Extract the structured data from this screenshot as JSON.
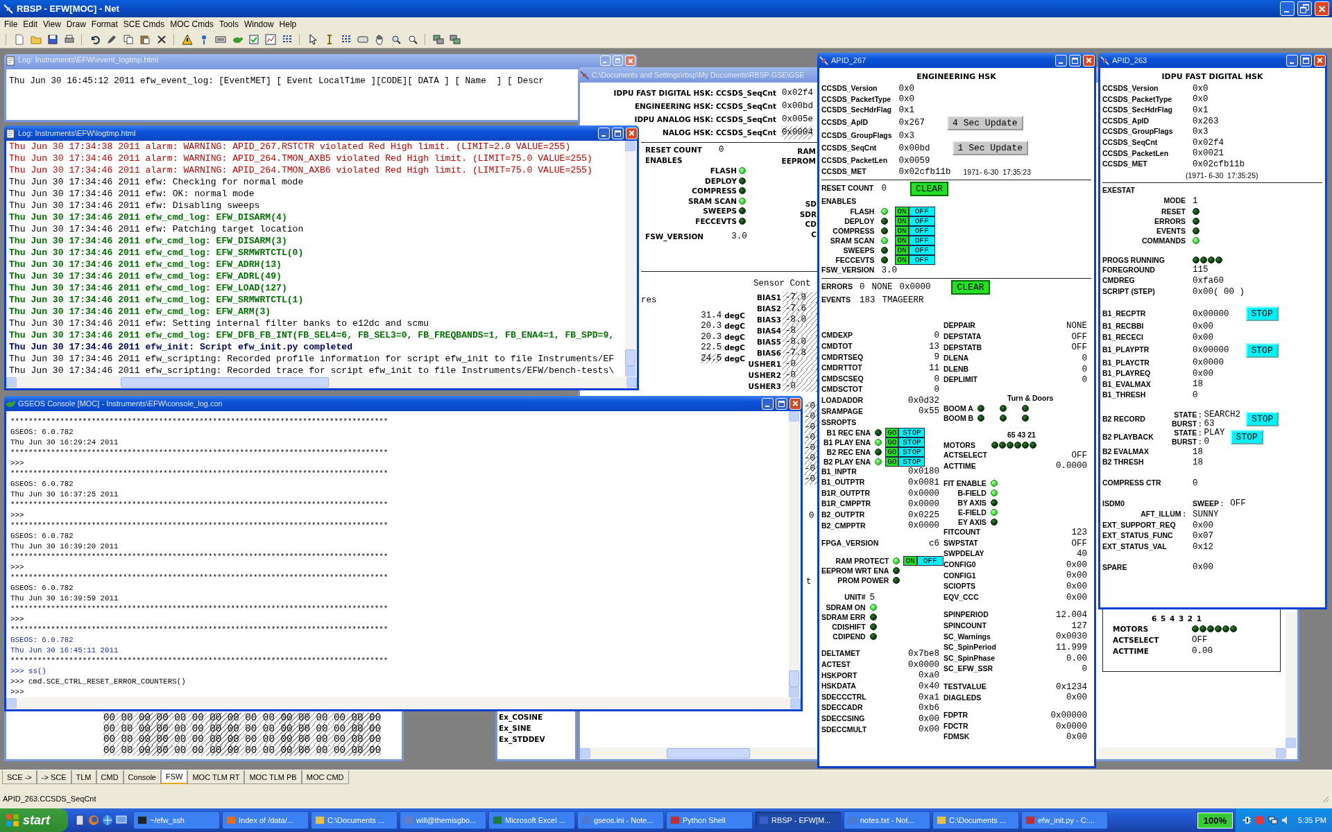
{
  "app": {
    "title": "RBSP - EFW[MOC] - Net",
    "menu": [
      "File",
      "Edit",
      "View",
      "Draw",
      "Format",
      "SCE Cmds",
      "MOC Cmds",
      "Tools",
      "Window",
      "Help"
    ]
  },
  "event_log_window": {
    "title": "Log: Instruments\\EFW\\event_logtmp.html",
    "line": "Thu Jun 30 16:45:12 2011 efw_event_log: [EventMET] [ Event LocalTime ][CODE][ DATA ] [ Name  ] [ Descr"
  },
  "display_window": {
    "title": "C:\\Documents and Settings\\rbsp\\My Documents\\RBSP-GSE\\GSE",
    "seq_rows": [
      {
        "label": "IDPU FAST DIGITAL HSK: CCSDS_SeqCnt",
        "value": "0x02f4",
        "stale": false
      },
      {
        "label": "ENGINEERING HSK: CCSDS_SeqCnt",
        "value": "0x00bd",
        "stale": false
      },
      {
        "label": "IDPU ANALOG HSK: CCSDS_SeqCnt",
        "value": "0x005e",
        "stale": false
      },
      {
        "label": "NALOG HSK: CCSDS_SeqCnt",
        "value": "0x0004",
        "stale": true
      }
    ],
    "engineering": {
      "reset_label": "RESET COUNT",
      "reset_value": "0",
      "enables_label": "ENABLES",
      "enables": [
        {
          "label": "FLASH",
          "on": true
        },
        {
          "label": "DEPLOY",
          "on": false
        },
        {
          "label": "COMPRESS",
          "on": false
        },
        {
          "label": "SRAM SCAN",
          "on": true
        },
        {
          "label": "SWEEPS",
          "on": false
        },
        {
          "label": "FECCEVTS",
          "on": false
        }
      ],
      "fsw_label": "FSW_VERSION",
      "fsw_value": "3.0",
      "cut_labels_top": [
        "RAM",
        "EEPROM"
      ],
      "cut_labels_bottom": [
        "SD",
        "SDR",
        "CD",
        "C"
      ]
    },
    "sensors": {
      "temps_heading": "res",
      "temps": [
        {
          "value": "31.4",
          "unit": "degC",
          "stale": false
        },
        {
          "value": "20.3",
          "unit": "degC",
          "stale": false
        },
        {
          "value": "20.3",
          "unit": "degC",
          "stale": false
        },
        {
          "value": "22.5",
          "unit": "degC",
          "stale": false
        },
        {
          "value": "24.5",
          "unit": "degC",
          "stale": true
        }
      ],
      "heading": "Sensor Cont",
      "rows": [
        {
          "label": "BIAS1",
          "value": "-7.9"
        },
        {
          "label": "BIAS2",
          "value": "-7.6"
        },
        {
          "label": "BIAS3",
          "value": "-8.0"
        },
        {
          "label": "BIAS4",
          "value": "-8"
        },
        {
          "label": "BIAS5",
          "value": "-8.0"
        },
        {
          "label": "BIAS6",
          "value": "-7.8"
        },
        {
          "label": "USHER1",
          "value": "-0"
        },
        {
          "label": "USHER2",
          "value": "-0"
        },
        {
          "label": "USHER3",
          "value": "-0"
        }
      ],
      "more_values": [
        "-0",
        "-0",
        "-0",
        "-0",
        "-0",
        "-0",
        "-0",
        "-0"
      ],
      "fragments": [
        "0",
        "t"
      ]
    },
    "motors_box": {
      "digits": "6 5 4 3 2 1",
      "label": "MOTORS",
      "lamps": [
        false,
        false,
        false,
        false,
        false,
        false
      ],
      "rows": [
        {
          "label": "ACTSELECT",
          "value": "OFF"
        },
        {
          "label": "ACTTIME",
          "value": "0.00"
        }
      ]
    }
  },
  "log_window": {
    "title": "Log: Instruments\\EFW\\logtmp.html",
    "lines": [
      {
        "kind": "alarm",
        "text": "Thu Jun 30 17:34:38 2011 alarm: WARNING: APID_267.RSTCTR violated Red High limit. (LIMIT=2.0 VALUE=255)"
      },
      {
        "kind": "alarm",
        "text": "Thu Jun 30 17:34:46 2011 alarm: WARNING: APID_264.TMON_AXB5 violated Red High limit. (LIMIT=75.0 VALUE=255)"
      },
      {
        "kind": "alarm",
        "text": "Thu Jun 30 17:34:46 2011 alarm: WARNING: APID_264.TMON_AXB6 violated Red High limit. (LIMIT=75.0 VALUE=255)"
      },
      {
        "kind": "info",
        "text": "Thu Jun 30 17:34:46 2011 efw: Checking for normal mode"
      },
      {
        "kind": "info",
        "text": "Thu Jun 30 17:34:46 2011 efw: OK: normal mode"
      },
      {
        "kind": "info",
        "text": "Thu Jun 30 17:34:46 2011 efw: Disabling sweeps"
      },
      {
        "kind": "command",
        "text": "Thu Jun 30 17:34:46 2011 efw_cmd_log: EFW_DISARM(4)"
      },
      {
        "kind": "info",
        "text": "Thu Jun 30 17:34:46 2011 efw: Patching target location"
      },
      {
        "kind": "command",
        "text": "Thu Jun 30 17:34:46 2011 efw_cmd_log: EFW_DISARM(3)"
      },
      {
        "kind": "command",
        "text": "Thu Jun 30 17:34:46 2011 efw_cmd_log: EFW_SRMWRTCTL(0)"
      },
      {
        "kind": "command",
        "text": "Thu Jun 30 17:34:46 2011 efw_cmd_log: EFW_ADRH(13)"
      },
      {
        "kind": "command",
        "text": "Thu Jun 30 17:34:46 2011 efw_cmd_log: EFW_ADRL(49)"
      },
      {
        "kind": "command",
        "text": "Thu Jun 30 17:34:46 2011 efw_cmd_log: EFW_LOAD(127)"
      },
      {
        "kind": "command",
        "text": "Thu Jun 30 17:34:46 2011 efw_cmd_log: EFW_SRMWRTCTL(1)"
      },
      {
        "kind": "command",
        "text": "Thu Jun 30 17:34:46 2011 efw_cmd_log: EFW_ARM(3)"
      },
      {
        "kind": "info",
        "text": "Thu Jun 30 17:34:46 2011 efw: Setting internal filter banks to e12dc and scmu"
      },
      {
        "kind": "command",
        "text": "Thu Jun 30 17:34:46 2011 efw_cmd_log: EFW_DFB_FB_INT(FB_SEL4=6, FB_SEL3=0, FB_FREQBANDS=1, FB_ENA4=1, FB_SPD=9,"
      },
      {
        "kind": "script",
        "text": "Thu Jun 30 17:34:46 2011 efw_init: Script efw_init.py completed"
      },
      {
        "kind": "info",
        "text": "Thu Jun 30 17:34:46 2011 efw_scripting: Recorded profile information for script efw_init to file Instruments/EF"
      },
      {
        "kind": "info",
        "text": "Thu Jun 30 17:34:46 2011 efw_scripting: Recorded trace for script efw_init to file Instruments/EFW/bench-tests\\"
      }
    ]
  },
  "console_window": {
    "title": "GSEOS Console [MOC] - Instruments\\EFW\\console_log.con",
    "lines": [
      {
        "kind": "output",
        "text": "************************************************************************************"
      },
      {
        "kind": "output",
        "text": "GSEOS: 6.0.782"
      },
      {
        "kind": "output",
        "text": "Thu Jun 30 16:29:24 2011"
      },
      {
        "kind": "output",
        "text": "************************************************************************************"
      },
      {
        "kind": "output",
        "text": ">>>"
      },
      {
        "kind": "output",
        "text": "************************************************************************************"
      },
      {
        "kind": "output",
        "text": "GSEOS: 6.0.782"
      },
      {
        "kind": "output",
        "text": "Thu Jun 30 16:37:25 2011"
      },
      {
        "kind": "output",
        "text": "************************************************************************************"
      },
      {
        "kind": "output",
        "text": ">>>"
      },
      {
        "kind": "output",
        "text": "************************************************************************************"
      },
      {
        "kind": "output",
        "text": "GSEOS: 6.0.782"
      },
      {
        "kind": "output",
        "text": "Thu Jun 30 16:39:20 2011"
      },
      {
        "kind": "output",
        "text": "************************************************************************************"
      },
      {
        "kind": "output",
        "text": ">>>"
      },
      {
        "kind": "output",
        "text": "************************************************************************************"
      },
      {
        "kind": "output",
        "text": "GSEOS: 6.0.782"
      },
      {
        "kind": "output",
        "text": "Thu Jun 30 16:39:59 2011"
      },
      {
        "kind": "output",
        "text": "************************************************************************************"
      },
      {
        "kind": "output",
        "text": ">>>"
      },
      {
        "kind": "output",
        "text": "************************************************************************************"
      },
      {
        "kind": "highlight",
        "text": "GSEOS: 6.0.782"
      },
      {
        "kind": "highlight",
        "text": "Thu Jun 30 16:45:11 2011"
      },
      {
        "kind": "output",
        "text": "************************************************************************************"
      },
      {
        "kind": "highlight",
        "text": ">>> ss()"
      },
      {
        "kind": "output",
        "text": ">>> cmd.SCE_CTRL_RESET_ERROR_COUNTERS()"
      },
      {
        "kind": "output",
        "text": ">>>"
      }
    ]
  },
  "hex_window": {
    "rows": [
      "00 00 00 00 00 00 00 00 00 00 00 00 00 00 00 00",
      "00 00 00 00 00 00 00 00 00 00 00 00 00 00 00 00",
      "00 00 00 00 00 00 00 00 00 00 00 00 00 00 00 00",
      "00 00 00 00 00 00 00 00 00 00 00 00 00 00 00 00"
    ]
  },
  "function_list": {
    "items": [
      "Ex_COSINE",
      "Ex_SINE",
      "Ex_STDDEV"
    ]
  },
  "hsk_windows": [
    {
      "title": "APID_267",
      "sections": [
        {
          "columns": [
            [
              [
                {
                  "kind": "title",
                  "label": "ENGINEERING HSK"
                },
                {
                  "kind": "value",
                  "label": "CCSDS_Version",
                  "values": [
                    "0x0"
                  ]
                },
                {
                  "kind": "value",
                  "label": "CCSDS_PacketType",
                  "values": [
                    "0x0"
                  ]
                },
                {
                  "kind": "value",
                  "label": "CCSDS_SecHdrFlag",
                  "values": [
                    "0x1"
                  ]
                },
                {
                  "kind": "value",
                  "label": "CCSDS_ApID",
                  "values": [
                    "0x267"
                  ],
                  "button": {
                    "label": "4 Sec Update",
                    "kind": "update"
                  }
                },
                {
                  "kind": "value",
                  "label": "CCSDS_GroupFlags",
                  "values": [
                    "0x3"
                  ]
                },
                {
                  "kind": "value",
                  "label": "CCSDS_SeqCnt",
                  "values": [
                    "0x00bd"
                  ],
                  "button": {
                    "label": "1 Sec Update",
                    "kind": "update"
                  }
                },
                {
                  "kind": "value",
                  "label": "CCSDS_PacketLen",
                  "values": [
                    "0x0059"
                  ]
                },
                {
                  "kind": "value",
                  "label": "CCSDS_MET",
                  "values": [
                    "0x02cfb11b"
                  ],
                  "note": "1971- 6-30  17:35:23"
                }
              ]
            ]
          ]
        },
        {
          "divider": true,
          "columns": [
            [
              [
                {
                  "kind": "value",
                  "label": "RESET COUNT",
                  "values": [
                    "0"
                  ],
                  "button": {
                    "label": "CLEAR",
                    "kind": "clear"
                  }
                },
                {
                  "kind": "heading",
                  "label": "ENABLES"
                },
                {
                  "kind": "lamp",
                  "label": "FLASH",
                  "lamps": [
                    true
                  ],
                  "switch": [
                    "ON",
                    "OFF"
                  ]
                },
                {
                  "kind": "lamp",
                  "label": "DEPLOY",
                  "lamps": [
                    false
                  ],
                  "switch": [
                    "ON",
                    "OFF"
                  ]
                },
                {
                  "kind": "lamp",
                  "label": "COMPRESS",
                  "lamps": [
                    false
                  ],
                  "switch": [
                    "ON",
                    "OFF"
                  ]
                },
                {
                  "kind": "lamp",
                  "label": "SRAM SCAN",
                  "lamps": [
                    true
                  ],
                  "switch": [
                    "ON",
                    "OFF"
                  ]
                },
                {
                  "kind": "lamp",
                  "label": "SWEEPS",
                  "lamps": [
                    false
                  ],
                  "switch": [
                    "ON",
                    "OFF"
                  ]
                },
                {
                  "kind": "lamp",
                  "label": "FECCEVTS",
                  "lamps": [
                    false
                  ],
                  "switch": [
                    "ON",
                    "OFF"
                  ]
                },
                {
                  "kind": "value",
                  "label": "FSW_VERSION",
                  "values": [
                    "3.0"
                  ]
                }
              ]
            ]
          ]
        },
        {
          "divider": true,
          "columns": [
            [
              [
                {
                  "kind": "value",
                  "label": "ERRORS",
                  "values": [
                    "0",
                    "NONE",
                    "0x0000"
                  ],
                  "button": {
                    "label": "CLEAR",
                    "kind": "clear"
                  }
                },
                {
                  "kind": "value",
                  "label": "EVENTS",
                  "values": [
                    "183",
                    "TMAGEERR"
                  ]
                }
              ]
            ]
          ]
        },
        {
          "columns": [
            [
              [
                {
                  "kind": "value",
                  "label": "CMDEXP",
                  "values": [
                    "0"
                  ]
                },
                {
                  "kind": "value",
                  "label": "CMDTOT",
                  "values": [
                    "13"
                  ]
                },
                {
                  "kind": "value",
                  "label": "CMDRTSEQ",
                  "values": [
                    "9"
                  ]
                },
                {
                  "kind": "value",
                  "label": "CMDRTTOT",
                  "values": [
                    "11"
                  ]
                },
                {
                  "kind": "value",
                  "label": "CMDSCSEQ",
                  "values": [
                    "0"
                  ]
                },
                {
                  "kind": "value",
                  "label": "CMDSCTOT",
                  "values": [
                    "0"
                  ]
                },
                {
                  "kind": "value",
                  "label": "LOADADDR",
                  "values": [
                    "0x0d32"
                  ]
                },
                {
                  "kind": "value",
                  "label": "SRAMPAGE",
                  "values": [
                    "0x55"
                  ]
                },
                {
                  "kind": "heading",
                  "label": "SSROPTS"
                },
                {
                  "kind": "lamp",
                  "label": "B1 REC ENA",
                  "lamps": [
                    false
                  ],
                  "switch": [
                    "GO",
                    "STOP"
                  ]
                },
                {
                  "kind": "lamp",
                  "label": "B1 PLAY ENA",
                  "lamps": [
                    true
                  ],
                  "switch": [
                    "GO",
                    "STOP"
                  ]
                },
                {
                  "kind": "lamp",
                  "label": "B2 REC ENA",
                  "lamps": [
                    false
                  ],
                  "switch": [
                    "GO",
                    "STOP"
                  ]
                },
                {
                  "kind": "lamp",
                  "label": "B2 PLAY ENA",
                  "lamps": [
                    true
                  ],
                  "switch": [
                    "GO",
                    "STOP"
                  ]
                },
                {
                  "kind": "value",
                  "label": "B1_INPTR",
                  "values": [
                    "0x0180"
                  ]
                },
                {
                  "kind": "value",
                  "label": "B1_OUTPTR",
                  "values": [
                    "0x0081"
                  ]
                },
                {
                  "kind": "value",
                  "label": "B1R_OUTPTR",
                  "values": [
                    "0x0000"
                  ]
                },
                {
                  "kind": "value",
                  "label": "B1R_CMPPTR",
                  "values": [
                    "0x0000"
                  ]
                },
                {
                  "kind": "value",
                  "label": "B2_OUTPTR",
                  "values": [
                    "0x0225"
                  ]
                },
                {
                  "kind": "value",
                  "label": "B2_CMPPTR",
                  "values": [
                    "0x0000"
                  ]
                }
              ],
              [
                {
                  "kind": "value",
                  "label": "FPGA_VERSION",
                  "values": [
                    "c6"
                  ]
                }
              ],
              [
                {
                  "kind": "lamp",
                  "label": "RAM PROTECT",
                  "lamps": [
                    true
                  ],
                  "switch": [
                    "ON",
                    "OFF"
                  ]
                },
                {
                  "kind": "lamp",
                  "label": "EEPROM WRT ENA",
                  "lamps": [
                    false
                  ]
                },
                {
                  "kind": "lamp",
                  "label": "PROM POWER",
                  "lamps": [
                    false
                  ]
                }
              ],
              [
                {
                  "kind": "sub",
                  "label": "UNIT#",
                  "values": [
                    "5"
                  ]
                },
                {
                  "kind": "lamp",
                  "label": "SDRAM ON",
                  "lamps": [
                    true
                  ]
                },
                {
                  "kind": "lamp",
                  "label": "SDRAM ERR",
                  "lamps": [
                    false
                  ]
                },
                {
                  "kind": "lamp",
                  "label": "CDISHIFT",
                  "lamps": [
                    false
                  ]
                },
                {
                  "kind": "lamp",
                  "label": "CDIPEND",
                  "lamps": [
                    false
                  ]
                }
              ],
              [
                {
                  "kind": "value",
                  "label": "DELTAMET",
                  "values": [
                    "0x7be8"
                  ]
                },
                {
                  "kind": "value",
                  "label": "ACTEST",
                  "values": [
                    "0x0000"
                  ]
                },
                {
                  "kind": "value",
                  "label": "HSKPORT",
                  "values": [
                    "0xa0"
                  ]
                },
                {
                  "kind": "value",
                  "label": "HSKDATA",
                  "values": [
                    "0x40"
                  ]
                },
                {
                  "kind": "value",
                  "label": "SDECCCTRL",
                  "values": [
                    "0xa1"
                  ]
                },
                {
                  "kind": "value",
                  "label": "SDECCADR",
                  "values": [
                    "0xb6"
                  ]
                },
                {
                  "kind": "value",
                  "label": "SDECCSING",
                  "values": [
                    "0x00"
                  ]
                },
                {
                  "kind": "value",
                  "label": "SDECCMULT",
                  "values": [
                    "0x00"
                  ]
                }
              ]
            ],
            [
              [
                {
                  "kind": "value",
                  "label": "DEPPAIR",
                  "values": [
                    "NONE"
                  ]
                },
                {
                  "kind": "value",
                  "label": "DEPSTATA",
                  "values": [
                    "OFF"
                  ]
                },
                {
                  "kind": "value",
                  "label": "DEPSTATB",
                  "values": [
                    "OFF"
                  ]
                },
                {
                  "kind": "value",
                  "label": "DLENA",
                  "values": [
                    "0"
                  ]
                },
                {
                  "kind": "value",
                  "label": "DLENB",
                  "values": [
                    "0"
                  ]
                },
                {
                  "kind": "value",
                  "label": "DEPLIMIT",
                  "values": [
                    "0"
                  ]
                }
              ],
              [
                {
                  "kind": "caption",
                  "label": "Turn & Doors"
                },
                {
                  "kind": "lamp_row",
                  "label": "BOOM A",
                  "lamps": [
                    false,
                    false,
                    false
                  ]
                },
                {
                  "kind": "lamp_row",
                  "label": "BOOM B",
                  "lamps": [
                    false,
                    false,
                    false
                  ]
                }
              ],
              [
                {
                  "kind": "caption",
                  "label": "65 43 21"
                },
                {
                  "kind": "lamp_row",
                  "label": "MOTORS",
                  "lamps": [
                    false,
                    false,
                    false,
                    false,
                    false,
                    false
                  ]
                },
                {
                  "kind": "value",
                  "label": "ACTSELECT",
                  "values": [
                    "OFF"
                  ]
                },
                {
                  "kind": "value",
                  "label": "ACTTIME",
                  "values": [
                    "0.0000"
                  ]
                }
              ],
              [
                {
                  "kind": "lamp",
                  "label": "FIT ENABLE",
                  "lamps": [
                    true
                  ]
                },
                {
                  "kind": "lamp",
                  "label": "B-FIELD",
                  "lamps": [
                    true
                  ]
                },
                {
                  "kind": "lamp",
                  "label": "BY AXIS",
                  "lamps": [
                    false
                  ]
                },
                {
                  "kind": "lamp",
                  "label": "E-FIELD",
                  "lamps": [
                    true
                  ]
                },
                {
                  "kind": "lamp",
                  "label": "EY AXIS",
                  "lamps": [
                    false
                  ]
                },
                {
                  "kind": "value",
                  "label": "FITCOUNT",
                  "values": [
                    "123"
                  ]
                },
                {
                  "kind": "value",
                  "label": "SWPSTAT",
                  "values": [
                    "OFF"
                  ]
                },
                {
                  "kind": "value",
                  "label": "SWPDELAY",
                  "values": [
                    "40"
                  ]
                },
                {
                  "kind": "value",
                  "label": "CONFIG0",
                  "values": [
                    "0x00"
                  ]
                },
                {
                  "kind": "value",
                  "label": "CONFIG1",
                  "values": [
                    "0x00"
                  ]
                },
                {
                  "kind": "value",
                  "label": "SCIOPTS",
                  "values": [
                    "0x00"
                  ]
                },
                {
                  "kind": "value",
                  "label": "EQV_CCC",
                  "values": [
                    "0x00"
                  ]
                }
              ],
              [
                {
                  "kind": "value",
                  "label": "SPINPERIOD",
                  "values": [
                    "12.004"
                  ]
                },
                {
                  "kind": "value",
                  "label": "SPINCOUNT",
                  "values": [
                    "127"
                  ]
                },
                {
                  "kind": "value",
                  "label": "SC_Warnings",
                  "values": [
                    "0x0030"
                  ]
                },
                {
                  "kind": "value",
                  "label": "SC_SpinPeriod",
                  "values": [
                    "11.999"
                  ]
                },
                {
                  "kind": "value",
                  "label": "SC_SpinPhase",
                  "values": [
                    "0.00"
                  ]
                },
                {
                  "kind": "value",
                  "label": "SC_EFW_SSR",
                  "values": [
                    "0"
                  ]
                }
              ],
              [
                {
                  "kind": "value",
                  "label": "TESTVALUE",
                  "values": [
                    "0x1234"
                  ]
                },
                {
                  "kind": "value",
                  "label": "DIAGLEDS",
                  "values": [
                    "0x00"
                  ]
                }
              ],
              [
                {
                  "kind": "value",
                  "label": "FDPTR",
                  "values": [
                    "0x00000"
                  ]
                },
                {
                  "kind": "value",
                  "label": "FDCTR",
                  "values": [
                    "0x0000"
                  ]
                },
                {
                  "kind": "value",
                  "label": "FDMSK",
                  "values": [
                    "0x00"
                  ]
                }
              ]
            ]
          ]
        }
      ]
    },
    {
      "title": "APID_263",
      "sections": [
        {
          "columns": [
            [
              [
                {
                  "kind": "title",
                  "label": "IDPU FAST DIGITAL HSK"
                },
                {
                  "kind": "value",
                  "label": "CCSDS_Version",
                  "values": [
                    "0x0"
                  ]
                },
                {
                  "kind": "value",
                  "label": "CCSDS_PacketType",
                  "values": [
                    "0x0"
                  ]
                },
                {
                  "kind": "value",
                  "label": "CCSDS_SecHdrFlag",
                  "values": [
                    "0x1"
                  ]
                },
                {
                  "kind": "value",
                  "label": "CCSDS_ApID",
                  "values": [
                    "0x263"
                  ]
                },
                {
                  "kind": "value",
                  "label": "CCSDS_GroupFlags",
                  "values": [
                    "0x3"
                  ]
                },
                {
                  "kind": "value",
                  "label": "CCSDS_SeqCnt",
                  "values": [
                    "0x02f4"
                  ]
                },
                {
                  "kind": "value",
                  "label": "CCSDS_PacketLen",
                  "values": [
                    "0x0021"
                  ]
                },
                {
                  "kind": "value",
                  "label": "CCSDS_MET",
                  "values": [
                    "0x02cfb11b"
                  ]
                },
                {
                  "kind": "note",
                  "label": "(1971- 6-30  17:35:25)"
                }
              ]
            ]
          ]
        },
        {
          "divider": true,
          "columns": [
            [
              [
                {
                  "kind": "heading",
                  "label": "EXESTAT"
                },
                {
                  "kind": "sub",
                  "label": "MODE",
                  "values": [
                    "1"
                  ]
                },
                {
                  "kind": "lamp",
                  "label": "RESET",
                  "lamps": [
                    false
                  ]
                },
                {
                  "kind": "lamp",
                  "label": "ERRORS",
                  "lamps": [
                    false
                  ]
                },
                {
                  "kind": "lamp",
                  "label": "EVENTS",
                  "lamps": [
                    false
                  ]
                },
                {
                  "kind": "lamp",
                  "label": "COMMANDS",
                  "lamps": [
                    true
                  ]
                }
              ],
              [
                {
                  "kind": "lamp_row",
                  "label": "PROGS RUNNING",
                  "lamps": [
                    false,
                    false,
                    false,
                    false
                  ]
                },
                {
                  "kind": "value",
                  "label": "FOREGROUND",
                  "values": [
                    "115"
                  ]
                },
                {
                  "kind": "value",
                  "label": "CMDREG",
                  "values": [
                    "0xfa60"
                  ]
                },
                {
                  "kind": "value",
                  "label": "SCRIPT (STEP)",
                  "values": [
                    "0x00( 00 )"
                  ]
                }
              ],
              [
                {
                  "kind": "value",
                  "label": "B1_RECPTR",
                  "values": [
                    "0x00000"
                  ],
                  "button": {
                    "label": "STOP",
                    "kind": "stop"
                  }
                },
                {
                  "kind": "value",
                  "label": "B1_RECBBI",
                  "values": [
                    "0x00"
                  ]
                },
                {
                  "kind": "value",
                  "label": "B1_RECECI",
                  "values": [
                    "0x00"
                  ]
                },
                {
                  "kind": "value",
                  "label": "B1_PLAYPTR",
                  "values": [
                    "0x00000"
                  ],
                  "button": {
                    "label": "STOP",
                    "kind": "stop"
                  }
                },
                {
                  "kind": "value",
                  "label": "B1_PLAYCTR",
                  "values": [
                    "0x0000"
                  ]
                },
                {
                  "kind": "value",
                  "label": "B1_PLAYREQ",
                  "values": [
                    "0x00"
                  ]
                },
                {
                  "kind": "value",
                  "label": "B1_EVALMAX",
                  "values": [
                    "18"
                  ]
                },
                {
                  "kind": "value",
                  "label": "B1_THRESH",
                  "values": [
                    "0"
                  ]
                }
              ],
              [
                {
                  "kind": "state",
                  "label": "B2 RECORD",
                  "state_label": "STATE :",
                  "state": "SEARCH2",
                  "burst_label": "BURST :",
                  "burst": "63",
                  "button": {
                    "label": "STOP",
                    "kind": "stop"
                  }
                },
                {
                  "kind": "state",
                  "label": "B2 PLAYBACK",
                  "state_label": "STATE :",
                  "state": "PLAY",
                  "burst_label": "BURST :",
                  "burst": "0",
                  "button": {
                    "label": "STOP",
                    "kind": "stop"
                  }
                },
                {
                  "kind": "value",
                  "label": "B2 EVALMAX",
                  "values": [
                    "18"
                  ]
                },
                {
                  "kind": "value",
                  "label": "B2 THRESH",
                  "values": [
                    "18"
                  ]
                }
              ],
              [
                {
                  "kind": "value",
                  "label": "COMPRESS CTR",
                  "values": [
                    "0"
                  ]
                }
              ],
              [
                {
                  "kind": "value",
                  "label": "ISDM0",
                  "sublabel": "SWEEP :",
                  "values": [
                    "OFF"
                  ]
                },
                {
                  "kind": "sub",
                  "label": "AFT_ILLUM :",
                  "values": [
                    "SUNNY"
                  ]
                },
                {
                  "kind": "value",
                  "label": "EXT_SUPPORT_REQ",
                  "values": [
                    "0x00"
                  ]
                },
                {
                  "kind": "value",
                  "label": "EXT_STATUS_FUNC",
                  "values": [
                    "0x07"
                  ]
                },
                {
                  "kind": "value",
                  "label": "EXT_STATUS_VAL",
                  "values": [
                    "0x12"
                  ]
                }
              ],
              [
                {
                  "kind": "value",
                  "label": "SPARE",
                  "values": [
                    "0x00"
                  ]
                }
              ]
            ]
          ]
        }
      ]
    }
  ],
  "tabs": [
    {
      "label": "SCE ->",
      "selected": false
    },
    {
      "label": "-> SCE",
      "selected": false
    },
    {
      "label": "TLM",
      "selected": false
    },
    {
      "label": "CMD",
      "selected": false
    },
    {
      "label": "Console",
      "selected": false
    },
    {
      "label": "FSW",
      "selected": true
    },
    {
      "label": "MOC TLM RT",
      "selected": false
    },
    {
      "label": "MOC TLM PB",
      "selected": false
    },
    {
      "label": "MOC CMD",
      "selected": false
    }
  ],
  "status_bar": {
    "text": "APID_263.CCSDS_SeqCnt"
  },
  "taskbar": {
    "start": "start",
    "items": [
      {
        "label": "~/efw_ssh",
        "selected": false
      },
      {
        "label": "Index of /data/...",
        "selected": false
      },
      {
        "label": "C:\\Documents ...",
        "selected": false
      },
      {
        "label": "will@themisgbo...",
        "selected": false
      },
      {
        "label": "Microsoft Excel ...",
        "selected": false
      },
      {
        "label": "gseos.ini - Note...",
        "selected": false
      },
      {
        "label": "Python Shell",
        "selected": false
      },
      {
        "label": "RBSP - EFW[M...",
        "selected": true
      },
      {
        "label": "notes.txt - Not...",
        "selected": false
      },
      {
        "label": "C:\\Documents ...",
        "selected": false
      },
      {
        "label": "efw_init.py - C:...",
        "selected": false
      }
    ],
    "battery": "100%",
    "time": "5:35 PM"
  }
}
